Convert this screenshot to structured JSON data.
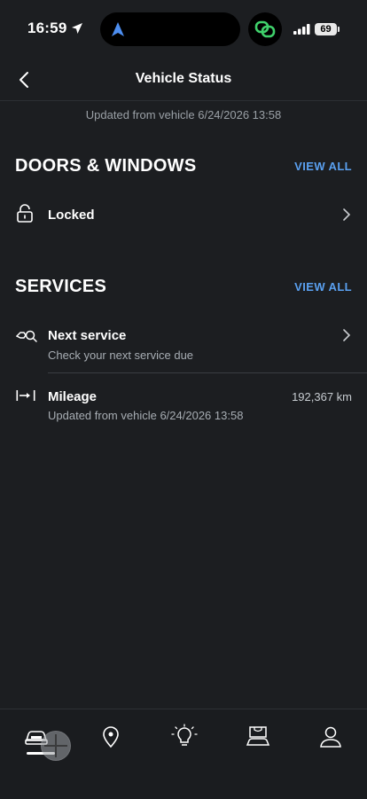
{
  "status_bar": {
    "time": "16:59",
    "battery": "69",
    "icons": [
      "location-arrow-icon",
      "navigation-icon",
      "app-link-icon",
      "signal-icon",
      "battery-icon"
    ]
  },
  "header": {
    "title": "Vehicle Status",
    "back_icon": "chevron-left-icon"
  },
  "updated_text": "Updated from vehicle 6/24/2026 13:58",
  "doors_windows": {
    "title": "DOORS & WINDOWS",
    "view_all": "VIEW ALL",
    "items": [
      {
        "icon": "lock-icon",
        "label": "Locked"
      }
    ]
  },
  "services": {
    "title": "SERVICES",
    "view_all": "VIEW ALL",
    "items": [
      {
        "icon": "service-icon",
        "label": "Next service",
        "sub": "Check your next service due"
      },
      {
        "icon": "mileage-icon",
        "label": "Mileage",
        "sub": "Updated from vehicle 6/24/2026 13:58",
        "value": "192,367 km"
      }
    ]
  },
  "tab_bar": {
    "tabs": [
      "car-icon",
      "map-pin-icon",
      "lightbulb-icon",
      "shop-icon",
      "profile-icon"
    ],
    "active": "car-icon"
  },
  "colors": {
    "background": "#1c1e21",
    "accent": "#5aa0f0",
    "secondary_text": "#9aa0a6"
  }
}
